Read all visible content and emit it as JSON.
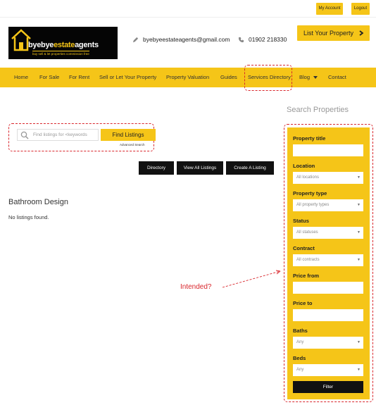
{
  "topbar": {
    "account_label": "My Account",
    "logout_label": "Logout"
  },
  "header": {
    "logo_brand_a": "byebye",
    "logo_brand_b": "estate",
    "logo_brand_c": "agents",
    "logo_tagline": "buy  sell & let properties commission free",
    "email": "byebyeestateagents@gmail.com",
    "phone": "01902 218330",
    "cta_label": "List Your Property"
  },
  "nav": {
    "items": [
      {
        "label": "Home"
      },
      {
        "label": "For Sale"
      },
      {
        "label": "For Rent"
      },
      {
        "label": "Sell or Let Your Property"
      },
      {
        "label": "Property Valuation"
      },
      {
        "label": "Guides"
      },
      {
        "label": "Services Directory"
      },
      {
        "label": "Blog"
      },
      {
        "label": "Contact"
      }
    ]
  },
  "search": {
    "placeholder": "Find listings for <keywords",
    "button_label": "Find Listings",
    "advanced_label": "Advanced Search"
  },
  "actions": {
    "directory_label": "Directory",
    "view_all_label": "View All Listings",
    "create_label": "Create A Listing"
  },
  "main": {
    "title": "Bathroom Design",
    "empty_message": "No listings found."
  },
  "annotation": {
    "note": "Intended?"
  },
  "sidebar": {
    "heading": "Search Properties",
    "property_title_label": "Property title",
    "location_label": "Location",
    "location_value": "All locations",
    "type_label": "Property type",
    "type_value": "All property types",
    "status_label": "Status",
    "status_value": "All statuses",
    "contract_label": "Contract",
    "contract_value": "All contracts",
    "price_from_label": "Price from",
    "price_to_label": "Price to",
    "baths_label": "Baths",
    "baths_value": "Any",
    "beds_label": "Beds",
    "beds_value": "Any",
    "filter_label": "Filter"
  },
  "colors": {
    "accent": "#f5c518",
    "dark": "#111111",
    "annotation": "#d9262c"
  },
  "icons": [
    "house-logo-icon",
    "pencil-icon",
    "phone-icon",
    "chevron-right-icon",
    "search-icon",
    "caret-down-icon"
  ]
}
